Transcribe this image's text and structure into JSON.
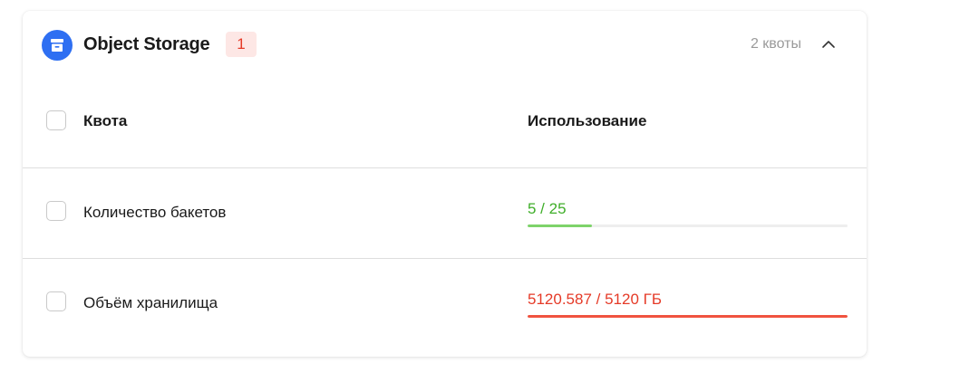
{
  "service": {
    "title": "Object Storage",
    "icon": "storage-box-icon",
    "badge": "1",
    "quota_count": "2 квоты"
  },
  "colors": {
    "accent": "#2e6ff2",
    "ok": "#3fae29",
    "ok_bar": "#7ed36a",
    "danger": "#e53a27",
    "danger_bar": "#f0533f"
  },
  "table": {
    "columns": [
      "Квота",
      "Использование"
    ],
    "rows": [
      {
        "name": "Количество бакетов",
        "usage": "5 / 25",
        "used": 5,
        "limit": 25,
        "status": "ok"
      },
      {
        "name": "Объём хранилища",
        "usage": "5120.587 / 5120 ГБ",
        "used": 5120.587,
        "limit": 5120,
        "status": "exceeded"
      }
    ]
  }
}
